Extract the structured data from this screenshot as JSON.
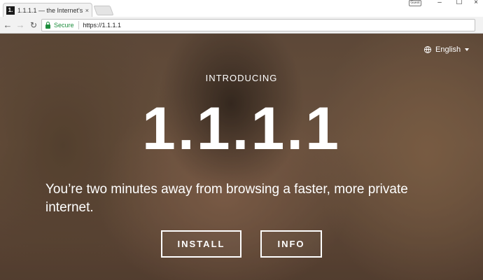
{
  "browser": {
    "tab_favicon": "1.",
    "tab_title": "1.1.1.1 — the Internet's F",
    "tab_close": "×",
    "user_badge": "Guest",
    "window_controls": {
      "minimize": "–",
      "maximize": "☐",
      "close": "×"
    },
    "nav": {
      "back": "←",
      "forward": "→",
      "reload": "↻"
    },
    "address_bar": {
      "secure_label": "Secure",
      "url": "https://1.1.1.1"
    }
  },
  "page": {
    "language_selector": {
      "label": "English",
      "icon": "globe-icon"
    },
    "intro": "INTRODUCING",
    "headline": "1.1.1.1",
    "tagline": "You’re two minutes away from browsing a faster, more private internet.",
    "buttons": {
      "install": "INSTALL",
      "info": "INFO"
    }
  },
  "colors": {
    "secure_green": "#1e8e3e",
    "text_on_hero": "#ffffff",
    "chrome_bg": "#f2f2f2"
  }
}
